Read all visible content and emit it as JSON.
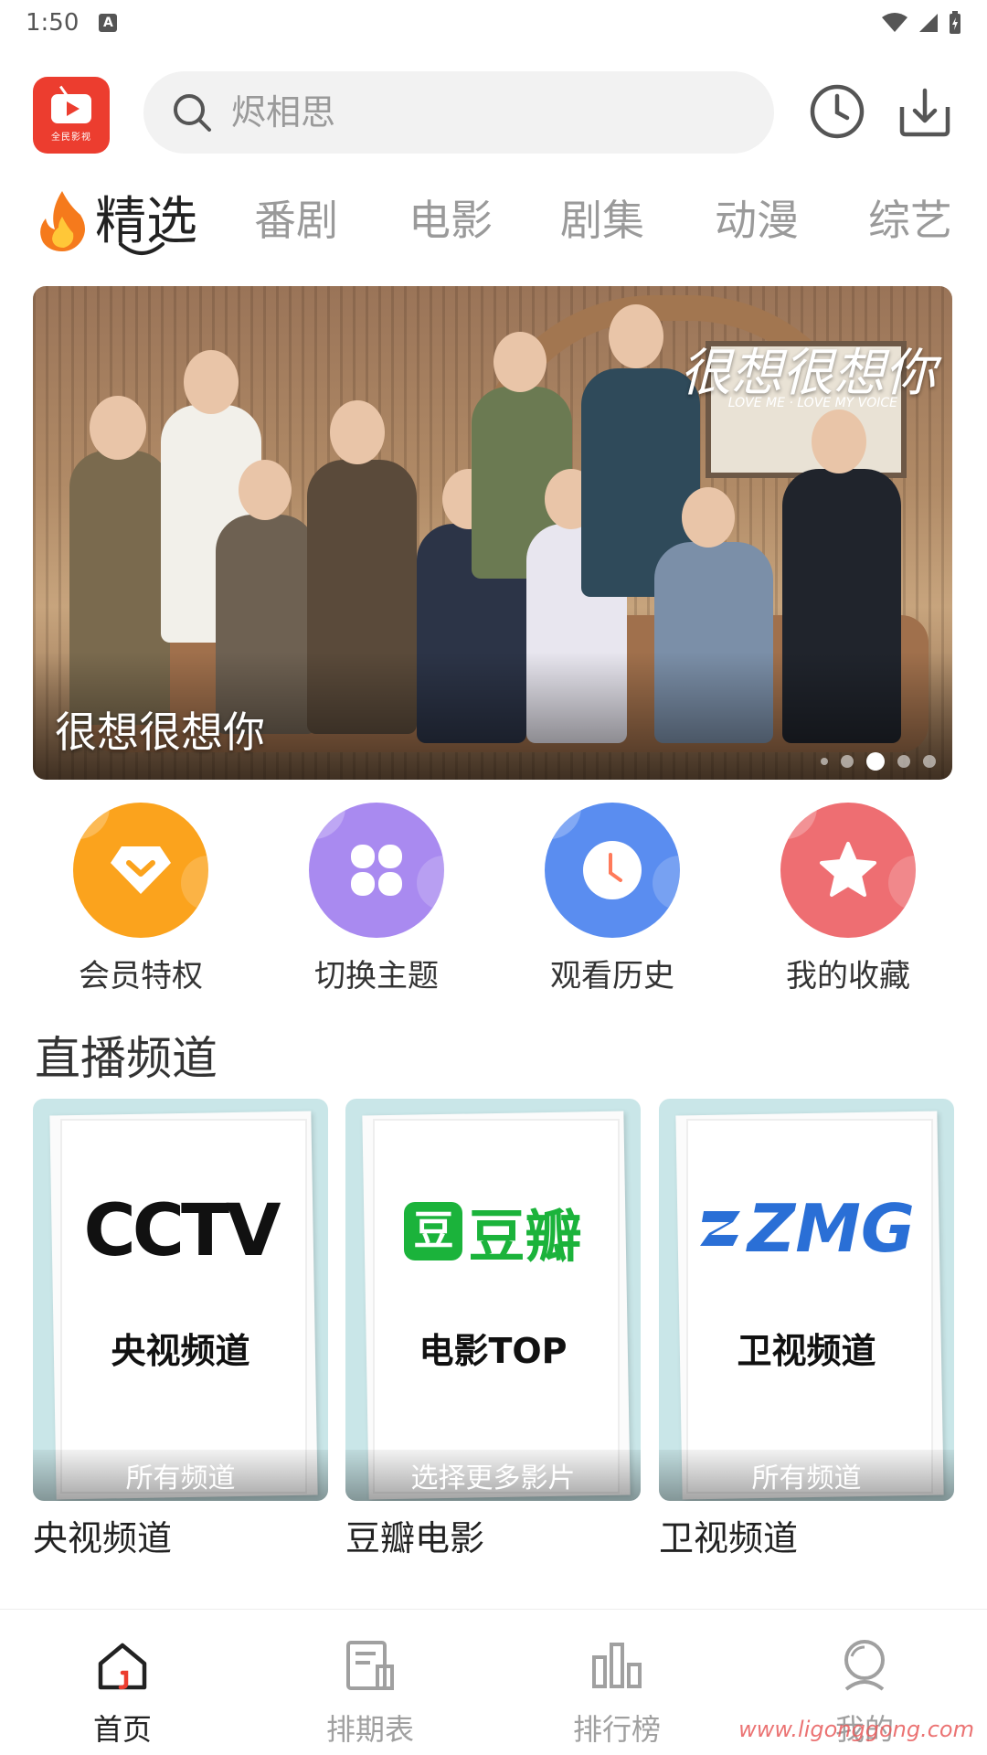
{
  "status_bar": {
    "time": "1:50",
    "notif_letter": "A"
  },
  "header": {
    "app_name": "全民影视",
    "search_placeholder": "烬相思"
  },
  "tabs": [
    {
      "label": "精选",
      "active": true
    },
    {
      "label": "番剧"
    },
    {
      "label": "电影"
    },
    {
      "label": "剧集"
    },
    {
      "label": "动漫"
    },
    {
      "label": "综艺"
    }
  ],
  "banner": {
    "caption": "很想很想你",
    "art_title": "很想很想你",
    "art_subtitle": "LOVE ME · LOVE MY VOICE",
    "dots_count": 5,
    "active_dot": 3
  },
  "quick_actions": [
    {
      "label": "会员特权",
      "icon": "diamond-icon",
      "color": "#FBA31D"
    },
    {
      "label": "切换主题",
      "icon": "clover-grid-icon",
      "color": "#A98AF0"
    },
    {
      "label": "观看历史",
      "icon": "clock-icon",
      "color": "#5A8DF0"
    },
    {
      "label": "我的收藏",
      "icon": "star-icon",
      "color": "#EE6E72"
    }
  ],
  "live_section": {
    "title": "直播频道",
    "channels": [
      {
        "logo": "CCTV",
        "card_title": "央视频道",
        "bar_text": "所有频道",
        "name": "央视频道"
      },
      {
        "logo": "豆瓣",
        "card_title": "电影TOP",
        "bar_text": "选择更多影片",
        "name": "豆瓣电影"
      },
      {
        "logo": "ZMG",
        "card_title": "卫视频道",
        "bar_text": "所有频道",
        "name": "卫视频道"
      }
    ]
  },
  "bottom_nav": [
    {
      "label": "首页",
      "icon": "home-icon",
      "active": true
    },
    {
      "label": "排期表",
      "icon": "schedule-icon"
    },
    {
      "label": "排行榜",
      "icon": "ranking-icon"
    },
    {
      "label": "我的",
      "icon": "profile-icon"
    }
  ],
  "watermark": "www.ligonggong.com",
  "colors": {
    "accent": "#EC3D2F",
    "tab_inactive": "#9A9A9A"
  }
}
